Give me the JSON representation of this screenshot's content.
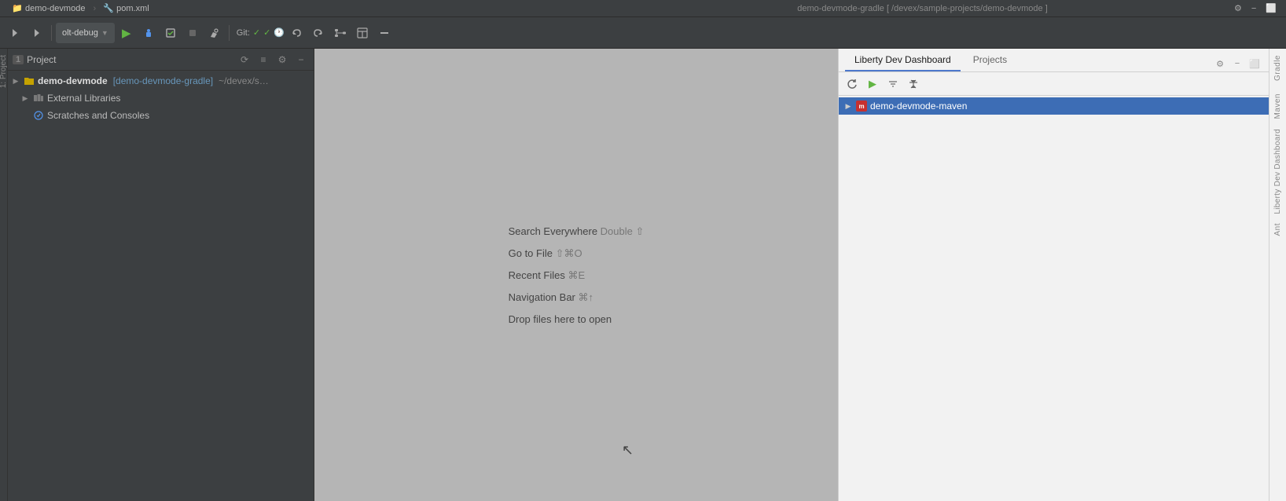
{
  "titlebar": {
    "tab1_icon": "📁",
    "tab1_label": "demo-devmode",
    "tab2_icon": "🔧",
    "tab2_label": "pom.xml",
    "center_text": "demo-devmode-gradle [ /devex/sample-projects/demo-devmode ]",
    "run_config": "olt-debug",
    "git_label": "Git:",
    "action_settings": "⚙",
    "action_minus": "−",
    "action_expand": "⬜"
  },
  "toolbar": {
    "btn_back": "←",
    "btn_forward": "→",
    "btn_run": "▶",
    "btn_debug": "🐛",
    "btn_coverage": "🔲",
    "btn_stop": "⬛",
    "btn_build": "🔨",
    "btn_undo": "↩",
    "btn_redo": "↪",
    "btn_vcs": "📊",
    "btn_bookmark": "🔖",
    "btn_layout": "⬜",
    "btn_minimize": "−"
  },
  "project_panel": {
    "title": "Project",
    "action_sync": "⟳",
    "action_collapse": "≡",
    "action_settings": "⚙",
    "action_close": "−",
    "root_item": {
      "label_bold": "demo-devmode",
      "label_module": "[demo-devmode-gradle]",
      "label_path": "~/devex/s…",
      "arrow": "▶"
    },
    "items": [
      {
        "label": "External Libraries",
        "icon": "📚",
        "arrow": "▶",
        "indent": 1
      },
      {
        "label": "Scratches and Consoles",
        "icon": "✏",
        "arrow": "",
        "indent": 1
      }
    ]
  },
  "editor": {
    "bg_color": "#b5b5b5",
    "hints": [
      {
        "text": "Search Everywhere",
        "key": "Double ⇧"
      },
      {
        "text": "Go to File",
        "key": "⇧⌘O"
      },
      {
        "text": "Recent Files",
        "key": "⌘E"
      },
      {
        "text": "Navigation Bar",
        "key": "⌘↑"
      },
      {
        "text": "Drop files here to open",
        "key": ""
      }
    ]
  },
  "right_panel": {
    "tab1": "Liberty Dev Dashboard",
    "tab2": "Projects",
    "action_settings": "⚙",
    "action_minimize": "−",
    "toolbar": {
      "btn_refresh": "⟳",
      "btn_play": "▶",
      "btn_settings1": "≡",
      "btn_settings2": "⇅"
    },
    "tree": [
      {
        "label": "demo-devmode-maven",
        "icon": "m",
        "arrow": "▶",
        "selected": true
      }
    ]
  },
  "right_strip": {
    "labels": [
      "Gradle",
      "Maven",
      "Liberty Dev Dashboard",
      "Ant"
    ]
  },
  "left_strip": {
    "label": "1: Project"
  }
}
